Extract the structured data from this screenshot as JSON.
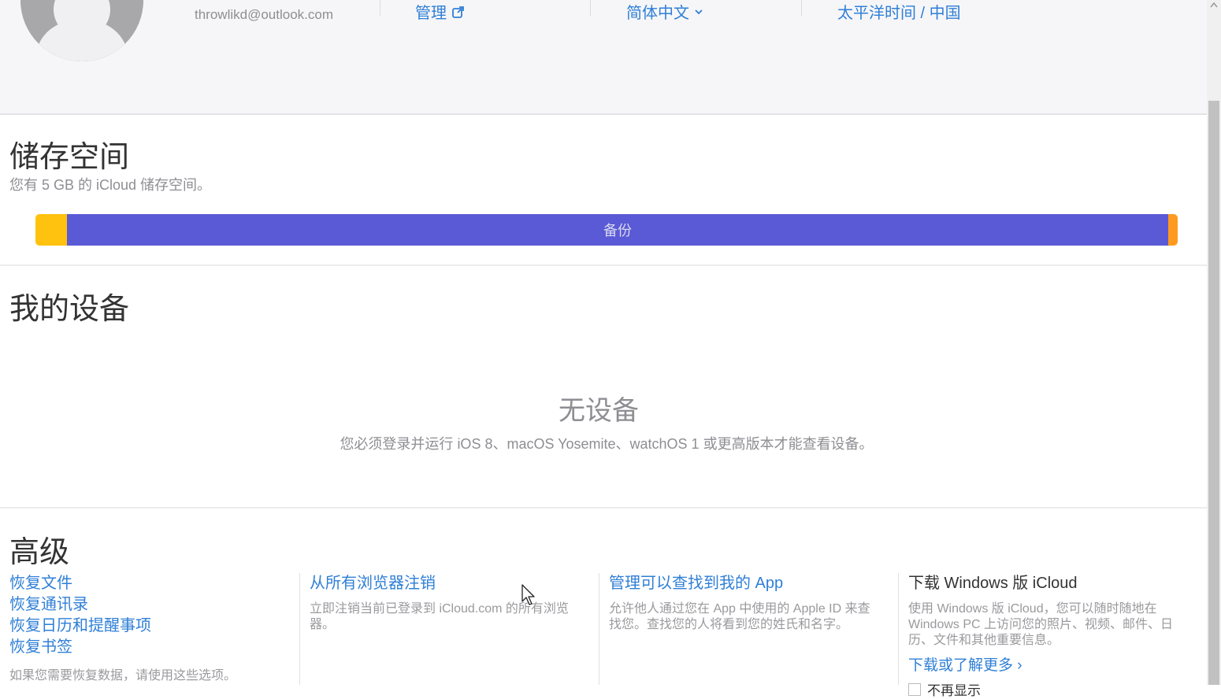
{
  "header": {
    "email": "throwlikd@outlook.com",
    "manage_label": "管理",
    "language_label": "简体中文",
    "timezone_label": "太平洋时间 / 中国"
  },
  "storage": {
    "title": "储存空间",
    "subtitle": "您有 5 GB 的 iCloud 储存空间。",
    "bar_label": "备份",
    "colors": {
      "yellow": "#ffc20e",
      "blue": "#5a5ad6",
      "orange": "#ff9a1e"
    }
  },
  "devices": {
    "title": "我的设备",
    "empty_title": "无设备",
    "empty_desc": "您必须登录并运行 iOS 8、macOS Yosemite、watchOS 1 或更高版本才能查看设备。"
  },
  "advanced": {
    "title": "高级",
    "restore": {
      "links": [
        "恢复文件",
        "恢复通讯录",
        "恢复日历和提醒事项",
        "恢复书签"
      ],
      "note": "如果您需要恢复数据，请使用这些选项。"
    },
    "signout": {
      "title": "从所有浏览器注销",
      "desc": "立即注销当前已登录到 iCloud.com 的所有浏览器。"
    },
    "findmy": {
      "title": "管理可以查找到我的 App",
      "desc": "允许他人通过您在 App 中使用的 Apple ID 来查找您。查找您的人将看到您的姓氏和名字。"
    },
    "windows": {
      "title": "下载 Windows 版 iCloud",
      "desc": "使用 Windows 版 iCloud，您可以随时随地在 Windows PC 上访问您的照片、视频、邮件、日历、文件和其他重要信息。",
      "more_link": "下载或了解更多 ›",
      "checkbox_label": "不再显示"
    }
  },
  "icons": {
    "manage": "external-link-icon",
    "language": "chevron-down-icon"
  }
}
